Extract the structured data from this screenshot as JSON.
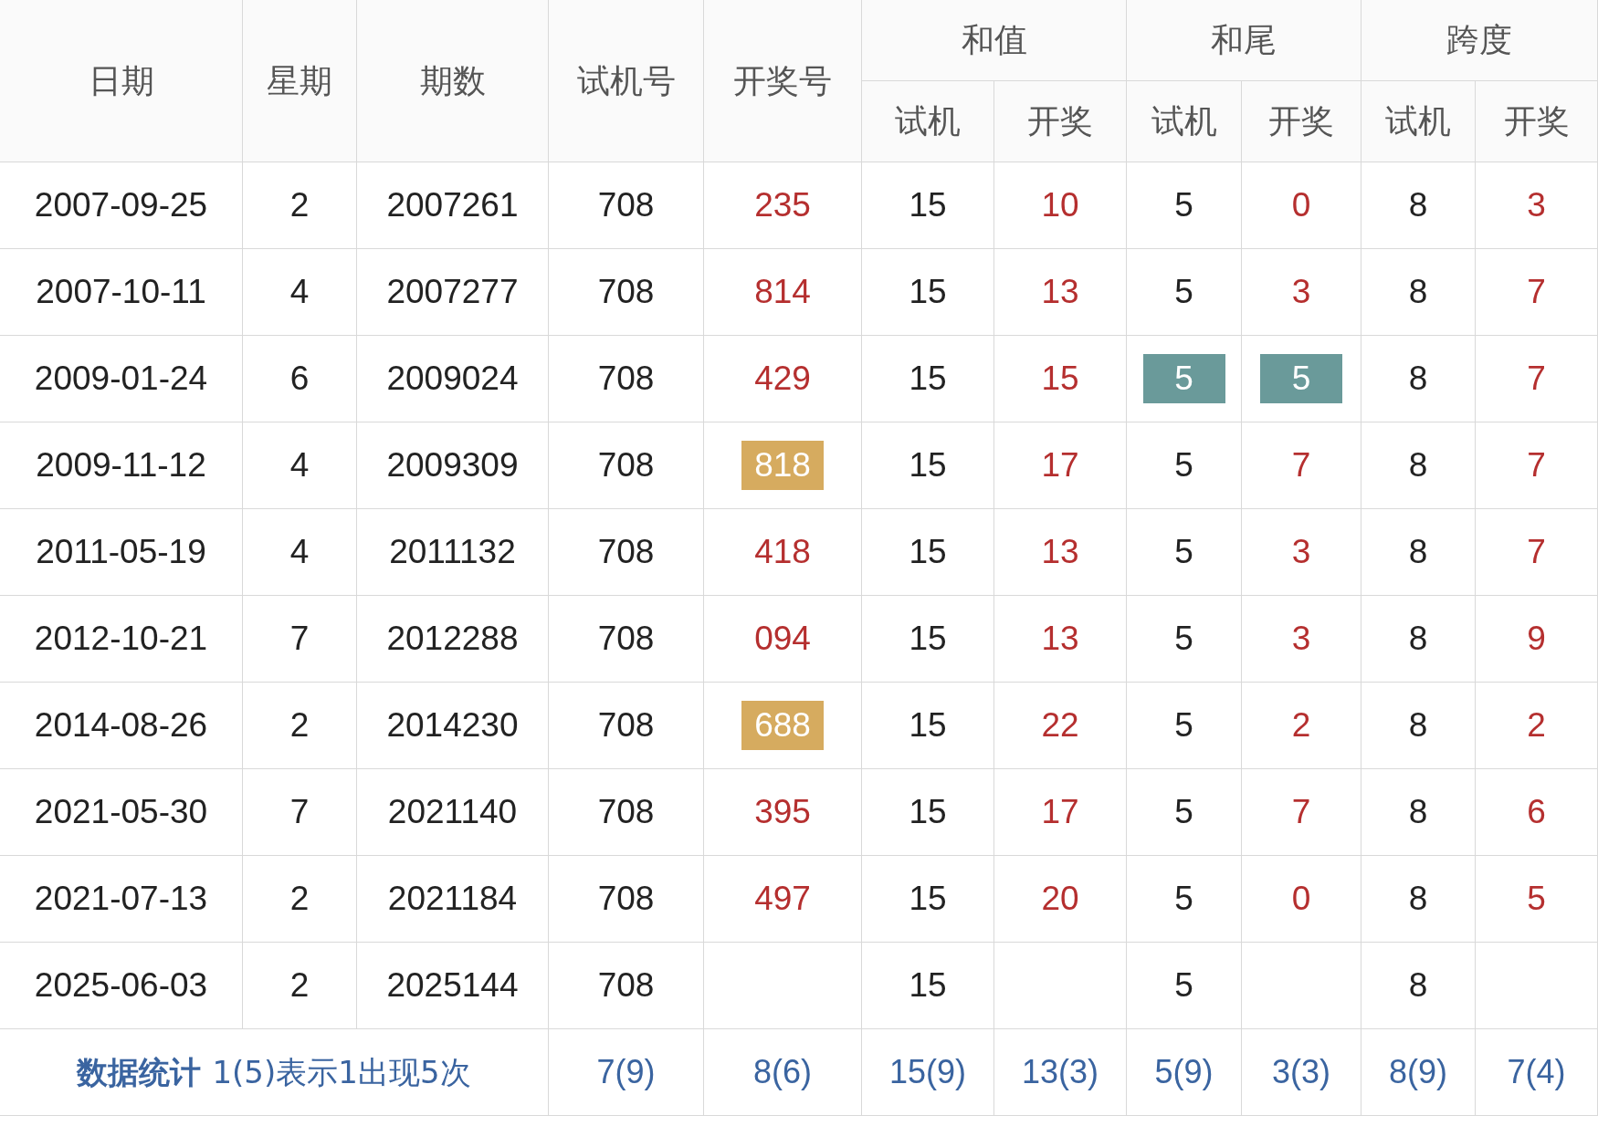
{
  "header": {
    "top": [
      {
        "label": "日期"
      },
      {
        "label": "星期"
      },
      {
        "label": "期数"
      },
      {
        "label": "试机号"
      },
      {
        "label": "开奖号"
      }
    ],
    "groups": [
      {
        "label": "和值",
        "sub": [
          "试机",
          "开奖"
        ]
      },
      {
        "label": "和尾",
        "sub": [
          "试机",
          "开奖"
        ]
      },
      {
        "label": "跨度",
        "sub": [
          "试机",
          "开奖"
        ]
      }
    ]
  },
  "rows": [
    {
      "cells": [
        {
          "kind": "dark",
          "text": "2007-09-25"
        },
        {
          "kind": "dark",
          "text": "2"
        },
        {
          "kind": "dark",
          "text": "2007261"
        },
        {
          "kind": "dark",
          "text": "708"
        },
        {
          "kind": "red",
          "text": "235"
        },
        {
          "kind": "dark",
          "text": "15"
        },
        {
          "kind": "red",
          "text": "10"
        },
        {
          "kind": "dark",
          "text": "5"
        },
        {
          "kind": "red",
          "text": "0"
        },
        {
          "kind": "dark",
          "text": "8"
        },
        {
          "kind": "red",
          "text": "3"
        }
      ]
    },
    {
      "cells": [
        {
          "kind": "dark",
          "text": "2007-10-11"
        },
        {
          "kind": "dark",
          "text": "4"
        },
        {
          "kind": "dark",
          "text": "2007277"
        },
        {
          "kind": "dark",
          "text": "708"
        },
        {
          "kind": "red",
          "text": "814"
        },
        {
          "kind": "dark",
          "text": "15"
        },
        {
          "kind": "red",
          "text": "13"
        },
        {
          "kind": "dark",
          "text": "5"
        },
        {
          "kind": "red",
          "text": "3"
        },
        {
          "kind": "dark",
          "text": "8"
        },
        {
          "kind": "red",
          "text": "7"
        }
      ]
    },
    {
      "cells": [
        {
          "kind": "dark",
          "text": "2009-01-24"
        },
        {
          "kind": "dark",
          "text": "6"
        },
        {
          "kind": "dark",
          "text": "2009024"
        },
        {
          "kind": "dark",
          "text": "708"
        },
        {
          "kind": "red",
          "text": "429"
        },
        {
          "kind": "dark",
          "text": "15"
        },
        {
          "kind": "red",
          "text": "15"
        },
        {
          "kind": "dark",
          "text": "5",
          "color": "#6a9a9a"
        },
        {
          "kind": "red",
          "text": "5",
          "color": "#6a9a9a"
        },
        {
          "kind": "dark",
          "text": "8"
        },
        {
          "kind": "red",
          "text": "7"
        }
      ]
    },
    {
      "cells": [
        {
          "kind": "dark",
          "text": "2009-11-12"
        },
        {
          "kind": "dark",
          "text": "4"
        },
        {
          "kind": "dark",
          "text": "2009309"
        },
        {
          "kind": "dark",
          "text": "708"
        },
        {
          "kind": "red",
          "text": "818",
          "color": "#d6ab5f"
        },
        {
          "kind": "dark",
          "text": "15"
        },
        {
          "kind": "red",
          "text": "17"
        },
        {
          "kind": "dark",
          "text": "5"
        },
        {
          "kind": "red",
          "text": "7"
        },
        {
          "kind": "dark",
          "text": "8"
        },
        {
          "kind": "red",
          "text": "7"
        }
      ]
    },
    {
      "cells": [
        {
          "kind": "dark",
          "text": "2011-05-19"
        },
        {
          "kind": "dark",
          "text": "4"
        },
        {
          "kind": "dark",
          "text": "2011132"
        },
        {
          "kind": "dark",
          "text": "708"
        },
        {
          "kind": "red",
          "text": "418"
        },
        {
          "kind": "dark",
          "text": "15"
        },
        {
          "kind": "red",
          "text": "13"
        },
        {
          "kind": "dark",
          "text": "5"
        },
        {
          "kind": "red",
          "text": "3"
        },
        {
          "kind": "dark",
          "text": "8"
        },
        {
          "kind": "red",
          "text": "7"
        }
      ]
    },
    {
      "cells": [
        {
          "kind": "dark",
          "text": "2012-10-21"
        },
        {
          "kind": "dark",
          "text": "7"
        },
        {
          "kind": "dark",
          "text": "2012288"
        },
        {
          "kind": "dark",
          "text": "708"
        },
        {
          "kind": "red",
          "text": "094"
        },
        {
          "kind": "dark",
          "text": "15"
        },
        {
          "kind": "red",
          "text": "13"
        },
        {
          "kind": "dark",
          "text": "5"
        },
        {
          "kind": "red",
          "text": "3"
        },
        {
          "kind": "dark",
          "text": "8"
        },
        {
          "kind": "red",
          "text": "9"
        }
      ]
    },
    {
      "cells": [
        {
          "kind": "dark",
          "text": "2014-08-26"
        },
        {
          "kind": "dark",
          "text": "2"
        },
        {
          "kind": "dark",
          "text": "2014230"
        },
        {
          "kind": "dark",
          "text": "708"
        },
        {
          "kind": "red",
          "text": "688",
          "color": "#d6ab5f"
        },
        {
          "kind": "dark",
          "text": "15"
        },
        {
          "kind": "red",
          "text": "22"
        },
        {
          "kind": "dark",
          "text": "5"
        },
        {
          "kind": "red",
          "text": "2"
        },
        {
          "kind": "dark",
          "text": "8"
        },
        {
          "kind": "red",
          "text": "2"
        }
      ]
    },
    {
      "cells": [
        {
          "kind": "dark",
          "text": "2021-05-30"
        },
        {
          "kind": "dark",
          "text": "7"
        },
        {
          "kind": "dark",
          "text": "2021140"
        },
        {
          "kind": "dark",
          "text": "708"
        },
        {
          "kind": "red",
          "text": "395"
        },
        {
          "kind": "dark",
          "text": "15"
        },
        {
          "kind": "red",
          "text": "17"
        },
        {
          "kind": "dark",
          "text": "5"
        },
        {
          "kind": "red",
          "text": "7"
        },
        {
          "kind": "dark",
          "text": "8"
        },
        {
          "kind": "red",
          "text": "6"
        }
      ]
    },
    {
      "cells": [
        {
          "kind": "dark",
          "text": "2021-07-13"
        },
        {
          "kind": "dark",
          "text": "2"
        },
        {
          "kind": "dark",
          "text": "2021184"
        },
        {
          "kind": "dark",
          "text": "708"
        },
        {
          "kind": "red",
          "text": "497"
        },
        {
          "kind": "dark",
          "text": "15"
        },
        {
          "kind": "red",
          "text": "20"
        },
        {
          "kind": "dark",
          "text": "5"
        },
        {
          "kind": "red",
          "text": "0"
        },
        {
          "kind": "dark",
          "text": "8"
        },
        {
          "kind": "red",
          "text": "5"
        }
      ]
    },
    {
      "cells": [
        {
          "kind": "dark",
          "text": "2025-06-03"
        },
        {
          "kind": "dark",
          "text": "2"
        },
        {
          "kind": "dark",
          "text": "2025144"
        },
        {
          "kind": "dark",
          "text": "708"
        },
        {
          "kind": "empty"
        },
        {
          "kind": "dark",
          "text": "15"
        },
        {
          "kind": "empty"
        },
        {
          "kind": "dark",
          "text": "5"
        },
        {
          "kind": "empty"
        },
        {
          "kind": "dark",
          "text": "8"
        },
        {
          "kind": "empty"
        }
      ]
    }
  ],
  "footer": {
    "title": "数据统计",
    "note": "1(5)表示1出现5次",
    "stats": [
      "7(9)",
      "8(6)",
      "15(9)",
      "13(3)",
      "5(9)",
      "3(3)",
      "8(9)",
      "7(4)"
    ]
  }
}
